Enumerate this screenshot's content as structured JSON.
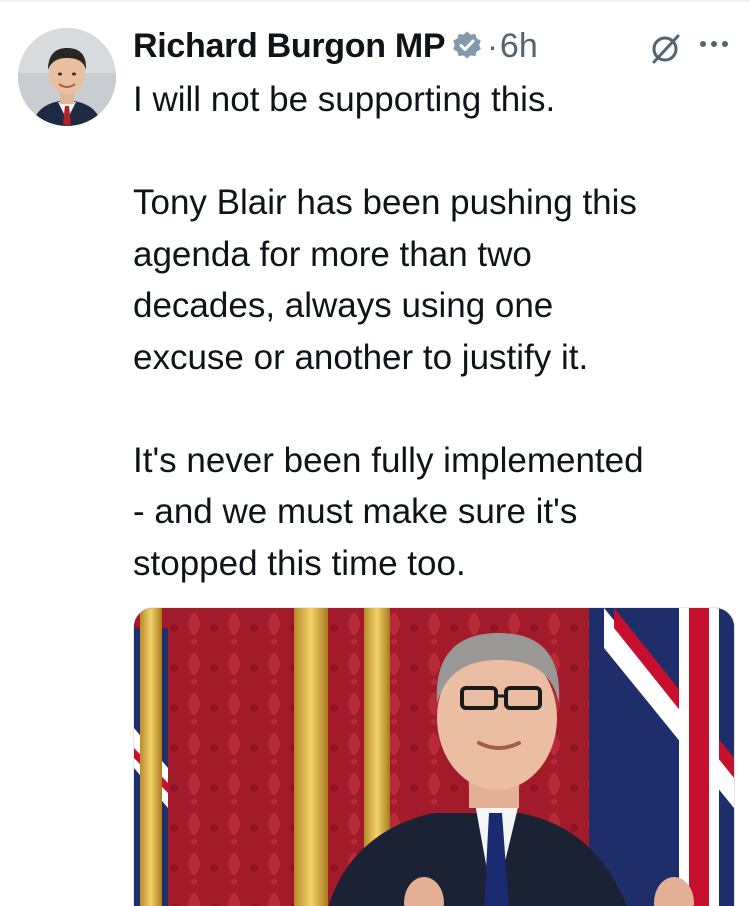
{
  "author": {
    "name": "Richard Burgon MP",
    "verified": true,
    "verified_icon": "verified-badge-icon",
    "separator": "·",
    "time": "6h"
  },
  "actions": {
    "grok_icon": "grok-icon",
    "more_icon": "more-options-icon"
  },
  "tweet": {
    "lines": [
      "I will not be supporting this.",
      "",
      "Tony Blair has been pushing this",
      "agenda for more than two",
      "decades, always using one",
      "excuse or another to justify it.",
      "",
      "It's never been fully implemented",
      "- and we must make sure it's",
      "stopped this time too."
    ]
  },
  "colors": {
    "text": "#0f1419",
    "secondary": "#536471",
    "verified": "#829aab",
    "media_wallpaper": "#a11b2a"
  }
}
